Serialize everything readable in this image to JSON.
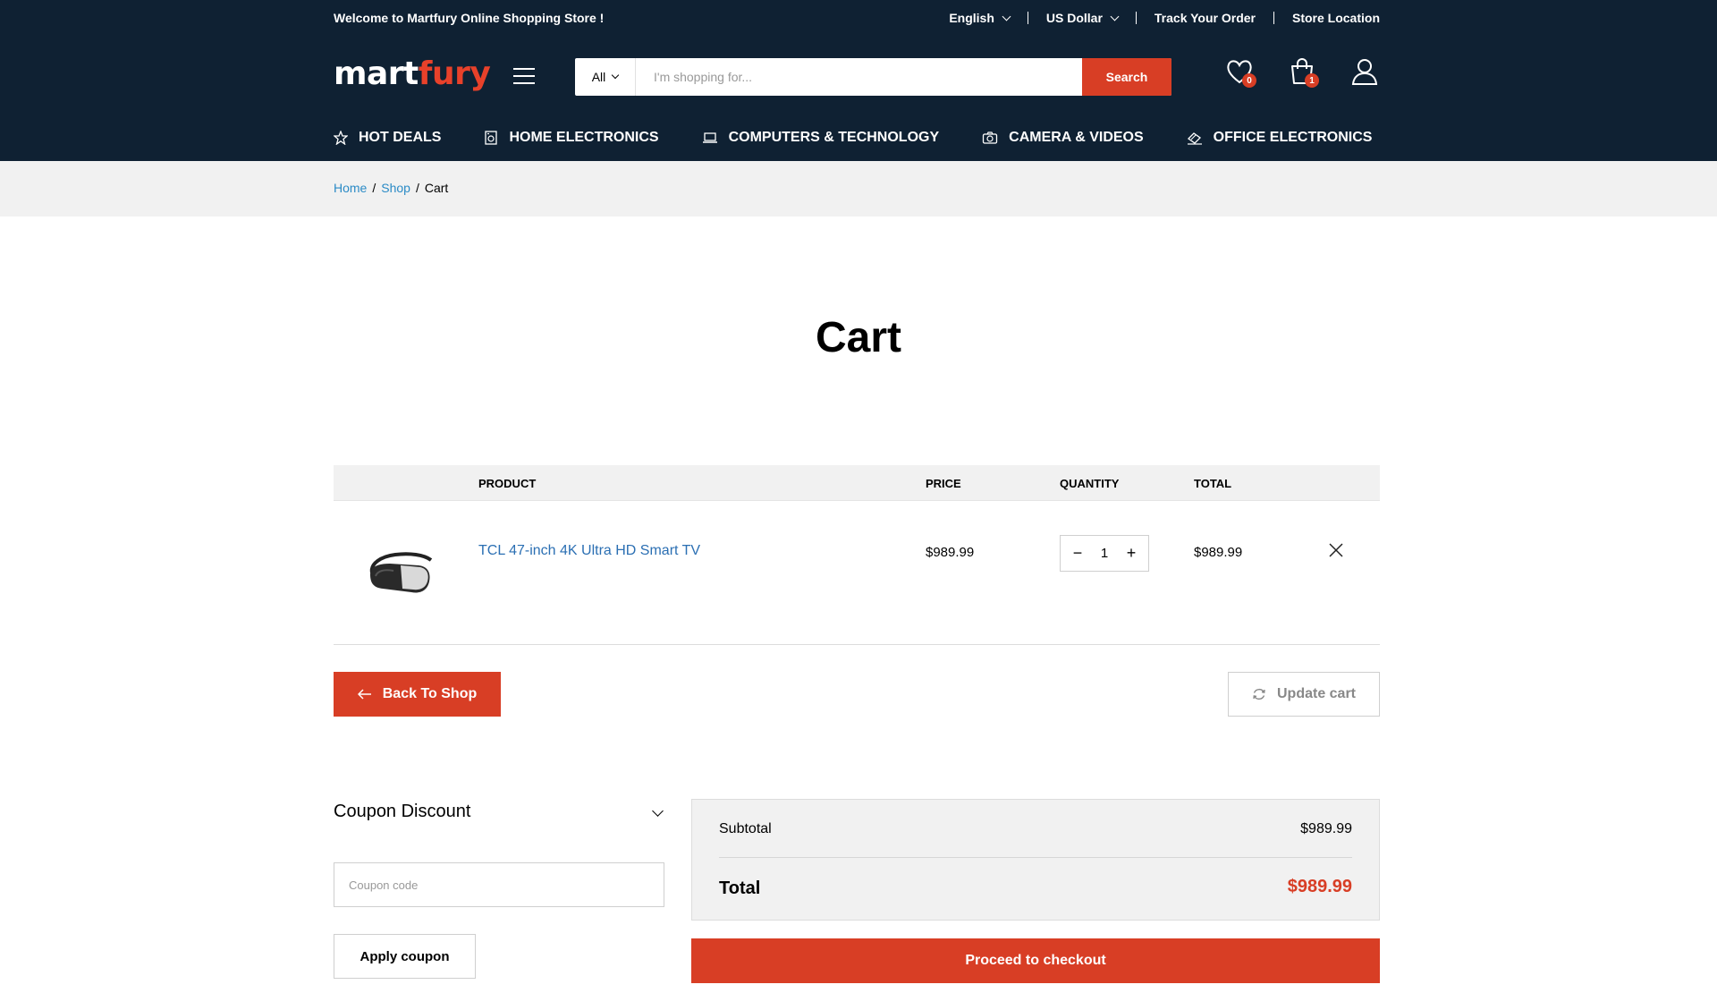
{
  "topbar": {
    "welcome": "Welcome to Martfury Online Shopping Store !",
    "language": "English",
    "currency": "US Dollar",
    "track_order": "Track Your Order",
    "store_location": "Store Location"
  },
  "logo": {
    "part1": "mart",
    "part2": "fury"
  },
  "search": {
    "category": "All",
    "placeholder": "I'm shopping for...",
    "button": "Search"
  },
  "header_icons": {
    "wishlist_count": "0",
    "cart_count": "1"
  },
  "nav": [
    {
      "label": "HOT DEALS",
      "icon": "star-icon"
    },
    {
      "label": "HOME ELECTRONICS",
      "icon": "fridge-icon"
    },
    {
      "label": "COMPUTERS & TECHNOLOGY",
      "icon": "laptop-icon"
    },
    {
      "label": "CAMERA & VIDEOS",
      "icon": "camera-icon"
    },
    {
      "label": "OFFICE ELECTRONICS",
      "icon": "printer-icon"
    }
  ],
  "breadcrumb": {
    "home": "Home",
    "shop": "Shop",
    "current": "Cart",
    "sep": "/"
  },
  "page_title": "Cart",
  "table": {
    "headers": {
      "product": "PRODUCT",
      "price": "PRICE",
      "quantity": "QUANTITY",
      "total": "TOTAL"
    },
    "rows": [
      {
        "name": "TCL 47-inch 4K Ultra HD Smart TV",
        "price": "$989.99",
        "quantity": "1",
        "total": "$989.99"
      }
    ]
  },
  "actions": {
    "back_to_shop": "Back To Shop",
    "update_cart": "Update cart"
  },
  "coupon": {
    "title": "Coupon Discount",
    "placeholder": "Coupon code",
    "apply": "Apply coupon"
  },
  "totals": {
    "subtotal_label": "Subtotal",
    "subtotal_value": "$989.99",
    "total_label": "Total",
    "total_value": "$989.99",
    "checkout": "Proceed to checkout"
  },
  "colors": {
    "header_bg": "#0f2133",
    "accent": "#d83e25",
    "link": "#2b8bc6"
  }
}
